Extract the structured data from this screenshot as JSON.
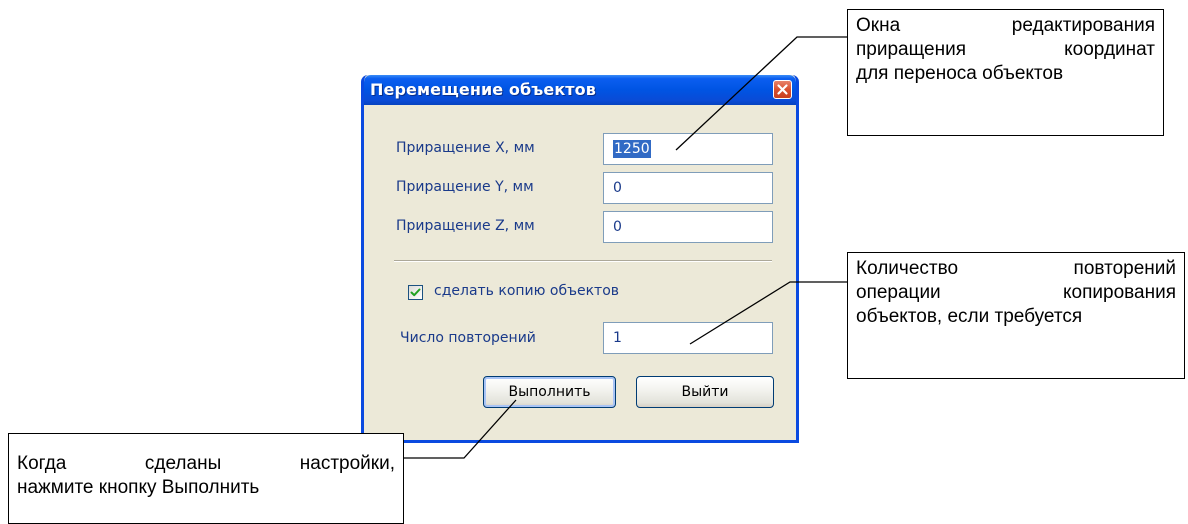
{
  "dialog": {
    "title": "Перемещение объектов",
    "fields": [
      {
        "label": "Приращение X, мм",
        "value": "1250",
        "selected": true
      },
      {
        "label": "Приращение Y, мм",
        "value": "0",
        "selected": false
      },
      {
        "label": "Приращение Z, мм",
        "value": "0",
        "selected": false
      }
    ],
    "copy_checkbox": {
      "label": "сделать копию объектов",
      "checked": true
    },
    "repeat": {
      "label": "Число повторений",
      "value": "1"
    },
    "buttons": {
      "run": "Выполнить",
      "exit": "Выйти"
    }
  },
  "callouts": {
    "edit_boxes": {
      "lines": [
        "Окна редактирования",
        "приращения координат",
        "для переноса объектов"
      ]
    },
    "repeat_count": {
      "lines": [
        "Количество повторений",
        "операции копирования",
        "объектов, если требуется"
      ]
    },
    "run_hint": {
      "lines": [
        "Когда сделаны настройки,",
        "нажмите кнопку Выполнить"
      ]
    }
  },
  "colors": {
    "titlebar": "#0054e3",
    "window_bg": "#ece9d8",
    "label_text": "#1a3a8a",
    "selection": "#316ac5",
    "close_button": "#d8502f",
    "checkmark": "#21a121"
  },
  "icons": {
    "close": "close-x-icon",
    "checkbox": "checkmark-icon"
  }
}
